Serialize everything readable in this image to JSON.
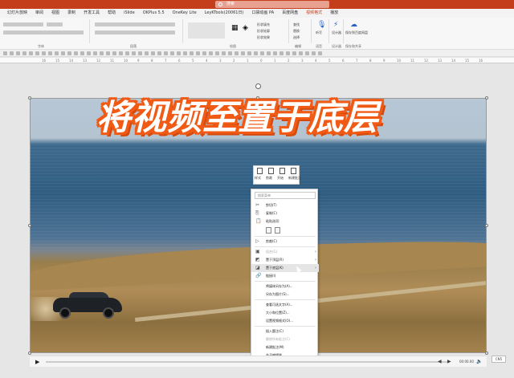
{
  "titlebar": {
    "search_placeholder": "搜索"
  },
  "tabs": [
    "幻灯片放映",
    "审阅",
    "视图",
    "录制",
    "开发工具",
    "帮助",
    "iSlide",
    "OKPlus 5.5",
    "OneKey Lite",
    "LeyKTools(20061日)",
    "口袋动画 PA",
    "百度网盘",
    "视频格式",
    "播放"
  ],
  "active_tab": "视频格式",
  "ribbon": {
    "groups": [
      "字体",
      "段落",
      "绘图",
      "编辑",
      "语音",
      "设计器",
      "保存和共享"
    ],
    "buttons": {
      "shape_fill": "形状填充",
      "shape_outline": "形状轮廓",
      "shape_effects": "形状效果",
      "find": "查找",
      "replace": "替换",
      "select": "选择",
      "dictate": "听写",
      "designer": "设计器",
      "save_share": "保存到百度网盘"
    }
  },
  "slide": {
    "headline": "将视频至置于底层"
  },
  "mini_toolbar": [
    {
      "label": "样式"
    },
    {
      "label": "剪裁"
    },
    {
      "label": "开始"
    },
    {
      "label": "新建批注"
    }
  ],
  "context_menu": {
    "search_placeholder": "搜索菜单",
    "items": [
      {
        "label": "剪切(T)",
        "icon": "✂",
        "disabled": false,
        "submenu": false
      },
      {
        "label": "复制(C)",
        "icon": "⎘",
        "disabled": false,
        "submenu": false
      },
      {
        "label": "粘贴选项:",
        "icon": "📋",
        "disabled": false,
        "submenu": false
      },
      {
        "label": "剪裁(C)",
        "icon": "▷",
        "disabled": false,
        "submenu": false
      },
      {
        "label": "组合(G)",
        "icon": "▣",
        "disabled": true,
        "submenu": true
      },
      {
        "label": "置于顶层(R)",
        "icon": "◩",
        "disabled": false,
        "submenu": true
      },
      {
        "label": "置于底层(K)",
        "icon": "◪",
        "disabled": false,
        "submenu": true
      },
      {
        "label": "链接(I)",
        "icon": "🔗",
        "disabled": false,
        "submenu": false
      },
      {
        "label": "将媒体另存为(A)...",
        "icon": "",
        "disabled": false,
        "submenu": false
      },
      {
        "label": "另存为图片(S)...",
        "icon": "",
        "disabled": false,
        "submenu": false
      },
      {
        "label": "查看可选文字(A)...",
        "icon": "",
        "disabled": false,
        "submenu": false
      },
      {
        "label": "大小和位置(Z)...",
        "icon": "",
        "disabled": false,
        "submenu": false
      },
      {
        "label": "设置视频格式(O)...",
        "icon": "",
        "disabled": false,
        "submenu": false
      },
      {
        "label": "插入题注(C)",
        "icon": "",
        "disabled": false,
        "submenu": false
      },
      {
        "label": "删除所有批注(C)",
        "icon": "",
        "disabled": true,
        "submenu": false
      },
      {
        "label": "新建批注(M)",
        "icon": "",
        "disabled": false,
        "submenu": false
      },
      {
        "label": "金子编辑器",
        "icon": "",
        "disabled": false,
        "submenu": false
      }
    ]
  },
  "player": {
    "time": "00:00.00"
  },
  "zoom_badge": "CN5"
}
